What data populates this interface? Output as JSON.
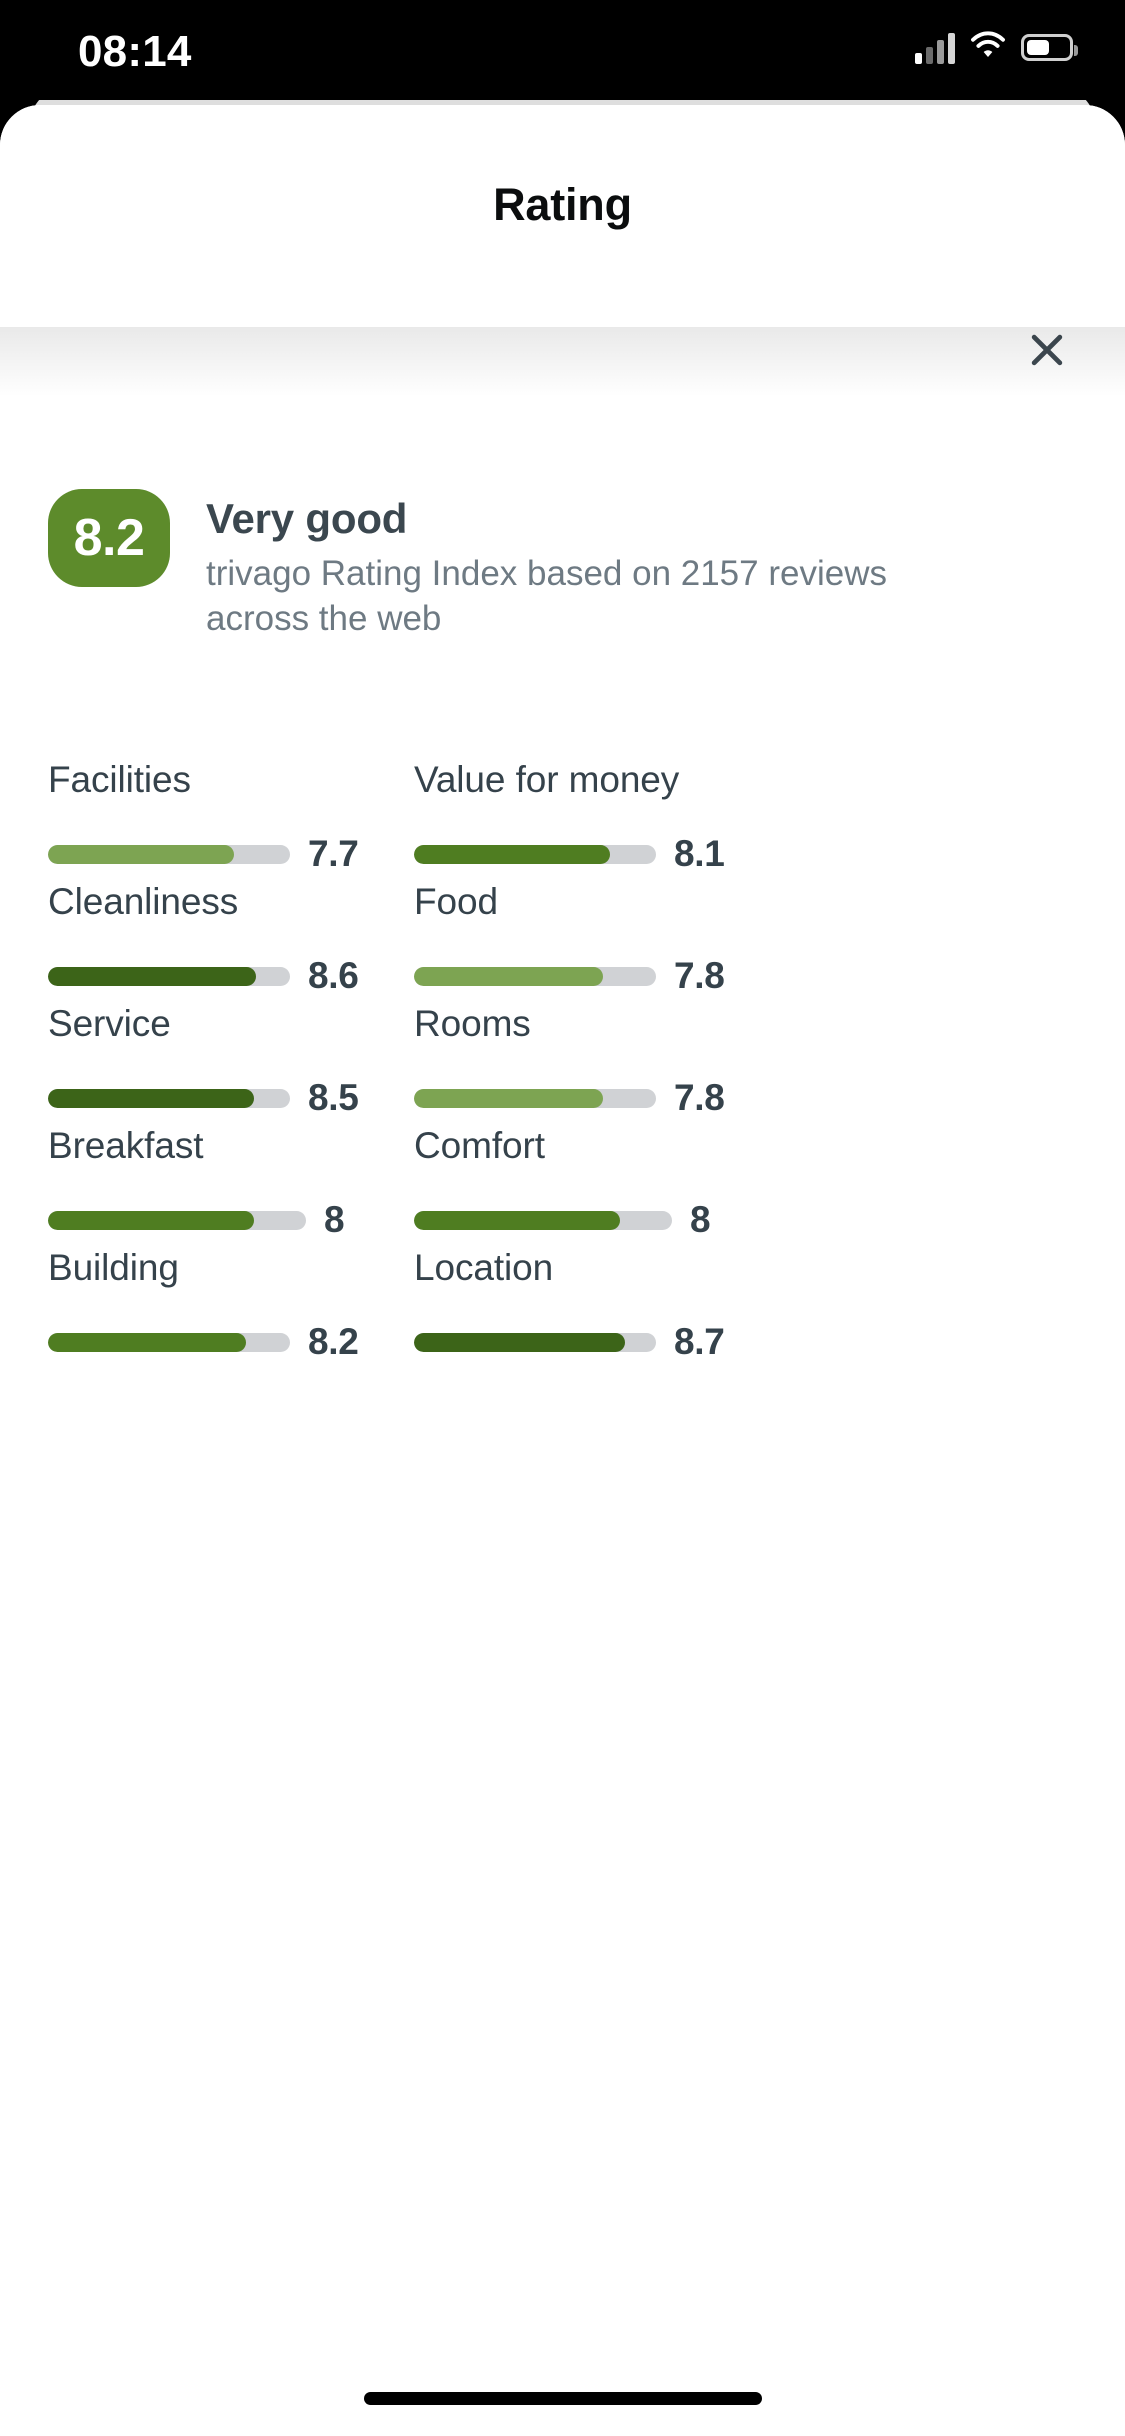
{
  "status_bar": {
    "time": "08:14",
    "signal_icon": "cellular-signal-icon",
    "wifi_icon": "wifi-icon",
    "battery_icon": "battery-icon"
  },
  "header": {
    "title": "Rating",
    "close_icon": "close-icon"
  },
  "summary": {
    "score": "8.2",
    "label": "Very good",
    "description": "trivago Rating Index based on 2157 reviews across the web"
  },
  "colors": {
    "badge_green": "#5d8b2b",
    "bar_light": "#7da452",
    "bar_mid": "#4f7d21",
    "bar_dark": "#3c6418",
    "track_gray": "#d0d2d5",
    "text_dark": "#35424b",
    "text_muted": "#6e7a83"
  },
  "chart_data": {
    "type": "bar",
    "title": "Rating",
    "xlabel": "",
    "ylabel": "",
    "ylim": [
      0,
      10
    ],
    "grid": false,
    "legend": "none",
    "categories": [
      "Facilities",
      "Value for money",
      "Cleanliness",
      "Food",
      "Service",
      "Rooms",
      "Breakfast",
      "Comfort",
      "Building",
      "Location"
    ],
    "values": [
      7.7,
      8.1,
      8.6,
      7.8,
      8.5,
      7.8,
      8,
      8,
      8.2,
      8.7
    ]
  },
  "ratings": [
    {
      "label": "Facilities",
      "value": "7.7",
      "pct": 77,
      "color": "#7da452",
      "track_w": 242
    },
    {
      "label": "Value for money",
      "value": "8.1",
      "pct": 81,
      "color": "#4f7d21",
      "track_w": 242
    },
    {
      "label": "Cleanliness",
      "value": "8.6",
      "pct": 86,
      "color": "#3c6418",
      "track_w": 242
    },
    {
      "label": "Food",
      "value": "7.8",
      "pct": 78,
      "color": "#7da452",
      "track_w": 242
    },
    {
      "label": "Service",
      "value": "8.5",
      "pct": 85,
      "color": "#3c6418",
      "track_w": 242
    },
    {
      "label": "Rooms",
      "value": "7.8",
      "pct": 78,
      "color": "#7da452",
      "track_w": 242
    },
    {
      "label": "Breakfast",
      "value": "8",
      "pct": 80,
      "color": "#4f7d21",
      "track_w": 258
    },
    {
      "label": "Comfort",
      "value": "8",
      "pct": 80,
      "color": "#4f7d21",
      "track_w": 258
    },
    {
      "label": "Building",
      "value": "8.2",
      "pct": 82,
      "color": "#4f7d21",
      "track_w": 242
    },
    {
      "label": "Location",
      "value": "8.7",
      "pct": 87,
      "color": "#3c6418",
      "track_w": 242
    }
  ],
  "home_indicator": "home-indicator"
}
